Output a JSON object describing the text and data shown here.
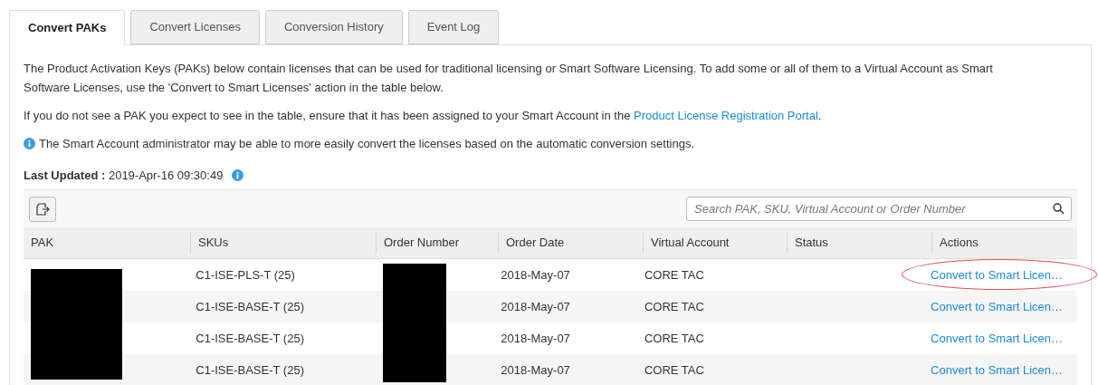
{
  "tabs": [
    {
      "label": "Convert PAKs",
      "selected": true
    },
    {
      "label": "Convert Licenses",
      "selected": false
    },
    {
      "label": "Conversion History",
      "selected": false
    },
    {
      "label": "Event Log",
      "selected": false
    }
  ],
  "intro": "The Product Activation Keys (PAKs) below contain licenses that can be used for traditional licensing or Smart Software Licensing. To add some or all of them to a Virtual Account as Smart Software Licenses, use the 'Convert to Smart Licenses' action in the table below.",
  "pak_note": {
    "text": "If you do not see a PAK you expect to see in the table, ensure that it has been assigned to your Smart Account in the",
    "link": "Product License Registration Portal",
    "after": "."
  },
  "info_note": "The Smart Account administrator may be able to more easily convert the licenses based on the automatic conversion settings.",
  "last_updated": {
    "label": "Last Updated :",
    "value": "2019-Apr-16 09:30:49"
  },
  "search": {
    "placeholder": "Search PAK, SKU, Virtual Account or Order Number"
  },
  "table": {
    "columns": [
      "PAK",
      "SKUs",
      "Order Number",
      "Order Date",
      "Virtual Account",
      "Status",
      "Actions"
    ],
    "rows": [
      {
        "sku": "C1-ISE-PLS-T (25)",
        "order_date": "2018-May-07",
        "virtual_account": "CORE TAC",
        "action": "Convert to Smart Licen…",
        "circled": true
      },
      {
        "sku": "C1-ISE-BASE-T (25)",
        "order_date": "2018-May-07",
        "virtual_account": "CORE TAC",
        "action": "Convert to Smart Licen…",
        "circled": false
      },
      {
        "sku": "C1-ISE-BASE-T (25)",
        "order_date": "2018-May-07",
        "virtual_account": "CORE TAC",
        "action": "Convert to Smart Licen…",
        "circled": false
      },
      {
        "sku": "C1-ISE-BASE-T (25)",
        "order_date": "2018-May-07",
        "virtual_account": "CORE TAC",
        "action": "Convert to Smart Licen…",
        "circled": false
      }
    ]
  }
}
